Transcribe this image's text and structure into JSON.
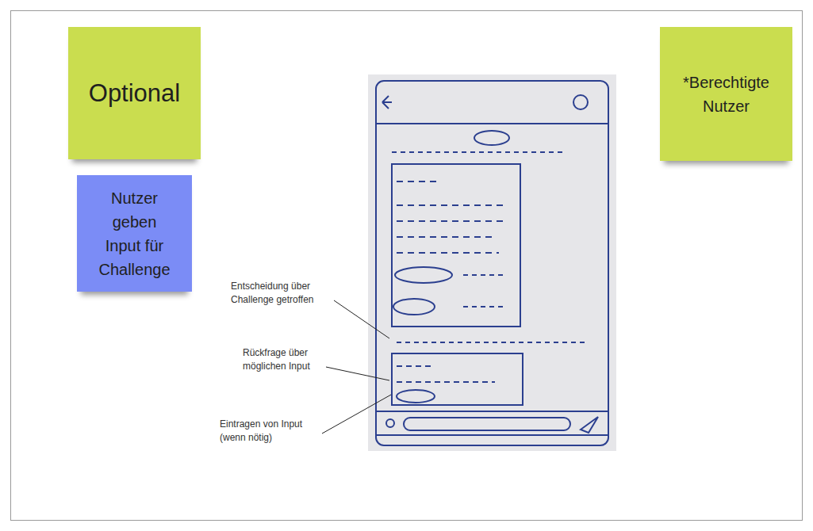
{
  "notes": [
    {
      "lines": [
        "Optional"
      ],
      "color": "#cadd4f",
      "size": "large"
    },
    {
      "lines": [
        "Nutzer",
        "geben",
        "Input für",
        "Challenge"
      ],
      "color": "#7b8cf6",
      "size": "small"
    },
    {
      "lines": [
        "*Berechtigte",
        "Nutzer"
      ],
      "color": "#cadd4f",
      "size": "small"
    }
  ],
  "annotations": [
    {
      "lines": [
        "Entscheidung über",
        "Challenge getroffen"
      ]
    },
    {
      "lines": [
        "Rückfrage über",
        "möglichen Input"
      ]
    },
    {
      "lines": [
        "Eintragen von Input",
        "(wenn nötig)"
      ]
    }
  ]
}
